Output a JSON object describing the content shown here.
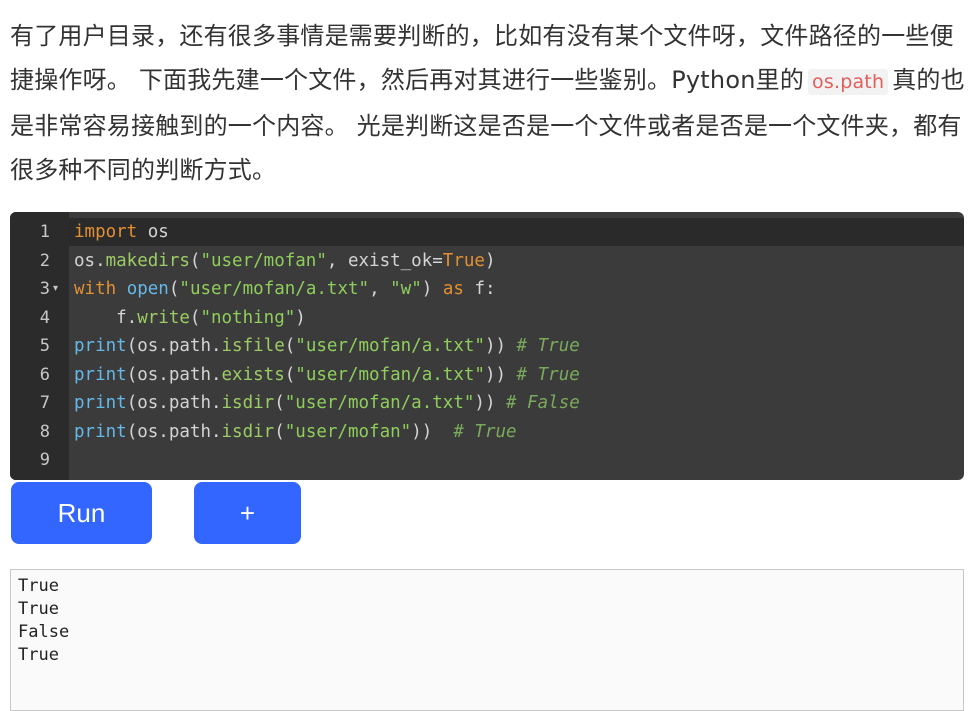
{
  "intro": {
    "part1": "有了用户目录，还有很多事情是需要判断的，比如有没有某个文件呀，文件路径的一些便捷操作呀。 下面我先建一个文件，然后再对其进行一些鉴别。Python里的",
    "inline_code": "os.path",
    "part2": "真的也是非常容易接触到的一个内容。 光是判断这是否是一个文件或者是否是一个文件夹，都有很多种不同的判断方式。"
  },
  "editor": {
    "line_numbers": [
      "1",
      "2",
      "3",
      "4",
      "5",
      "6",
      "7",
      "8",
      "9"
    ],
    "fold_marker": "▾",
    "lines": {
      "l1": {
        "kw": "import",
        "rest": " os"
      },
      "l2": {
        "obj": "os.",
        "fn": "makedirs",
        "p1": "(",
        "str": "\"user/mofan\"",
        "p2": ", exist_ok=",
        "const": "True",
        "p3": ")"
      },
      "l3": {
        "kw": "with",
        "sp": " ",
        "fn": "open",
        "p1": "(",
        "str1": "\"user/mofan/a.txt\"",
        "p2": ", ",
        "str2": "\"w\"",
        "p3": ") ",
        "kw2": "as",
        "p4": " f:"
      },
      "l4": {
        "indent": "    f.",
        "fn": "write",
        "p1": "(",
        "str": "\"nothing\"",
        "p2": ")"
      },
      "l5": {
        "fn": "print",
        "p1": "(os.path.",
        "attr": "isfile",
        "p2": "(",
        "str": "\"user/mofan/a.txt\"",
        "p3": ")) ",
        "cmt": "# True"
      },
      "l6": {
        "fn": "print",
        "p1": "(os.path.",
        "attr": "exists",
        "p2": "(",
        "str": "\"user/mofan/a.txt\"",
        "p3": ")) ",
        "cmt": "# True"
      },
      "l7": {
        "fn": "print",
        "p1": "(os.path.",
        "attr": "isdir",
        "p2": "(",
        "str": "\"user/mofan/a.txt\"",
        "p3": ")) ",
        "cmt": "# False"
      },
      "l8": {
        "fn": "print",
        "p1": "(os.path.",
        "attr": "isdir",
        "p2": "(",
        "str": "\"user/mofan\"",
        "p3": "))  ",
        "cmt": "# True"
      }
    }
  },
  "buttons": {
    "run": "Run",
    "add": "+"
  },
  "output": {
    "lines": [
      "True",
      "True",
      "False",
      "True"
    ]
  },
  "colors": {
    "accent": "#3366ff",
    "editor_bg": "#3b3b3b",
    "inline_code_fg": "#e35d5b"
  }
}
